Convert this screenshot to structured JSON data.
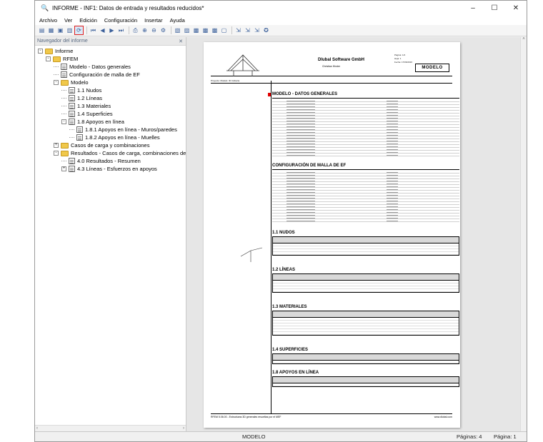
{
  "window": {
    "title": "INFORME - INF1: Datos de entrada y resultados reducidos*",
    "controls": [
      "–",
      "☐",
      "✕"
    ]
  },
  "menu": [
    "Archivo",
    "Ver",
    "Edición",
    "Configuración",
    "Insertar",
    "Ayuda"
  ],
  "navigator": {
    "header": "Navegador del informe",
    "items": [
      {
        "label": "Informe",
        "level": 0,
        "type": "folder",
        "exp": "-"
      },
      {
        "label": "RFEM",
        "level": 1,
        "type": "folder",
        "exp": "-"
      },
      {
        "label": "Modelo - Datos generales",
        "level": 2,
        "type": "page",
        "exp": ""
      },
      {
        "label": "Configuración de malla de EF",
        "level": 2,
        "type": "page",
        "exp": ""
      },
      {
        "label": "Modelo",
        "level": 2,
        "type": "folder",
        "exp": "-"
      },
      {
        "label": "1.1 Nudos",
        "level": 3,
        "type": "page",
        "exp": ""
      },
      {
        "label": "1.2 Líneas",
        "level": 3,
        "type": "page",
        "exp": ""
      },
      {
        "label": "1.3 Materiales",
        "level": 3,
        "type": "page",
        "exp": ""
      },
      {
        "label": "1.4 Superficies",
        "level": 3,
        "type": "page",
        "exp": ""
      },
      {
        "label": "1.8 Apoyos en línea",
        "level": 3,
        "type": "page",
        "exp": "-"
      },
      {
        "label": "1.8.1 Apoyos en línea - Muros/paredes",
        "level": 4,
        "type": "page",
        "exp": ""
      },
      {
        "label": "1.8.2 Apoyos en línea - Muelles",
        "level": 4,
        "type": "page",
        "exp": ""
      },
      {
        "label": "Casos de carga y combinaciones",
        "level": 2,
        "type": "folder",
        "exp": "+"
      },
      {
        "label": "Resultados - Casos de carga, combinaciones de c",
        "level": 2,
        "type": "folder",
        "exp": "-"
      },
      {
        "label": "4.0 Resultados - Resumen",
        "level": 3,
        "type": "page",
        "exp": ""
      },
      {
        "label": "4.3 Líneas - Esfuerzos en apoyos",
        "level": 3,
        "type": "page",
        "exp": "+"
      }
    ]
  },
  "document": {
    "company": "Dlubal Software GmbH",
    "company_sub": "Christian Hinder",
    "model_box": "MODELO",
    "meta": [
      "Página: 1/4",
      "Hoja: 1",
      "Fecha: 17/06/2016"
    ],
    "project_row": "Proyecto:          Modelo:   ID Cubierta",
    "sections": [
      {
        "title": "MODELO - DATOS GENERALES",
        "red": true
      },
      {
        "title": "CONFIGURACIÓN DE MALLA DE EF",
        "red": false
      },
      {
        "title": "1.1 NUDOS",
        "red": false
      },
      {
        "title": "1.2 LÍNEAS",
        "red": false
      },
      {
        "title": "1.3 MATERIALES",
        "red": false
      },
      {
        "title": "1.4 SUPERFICIES",
        "red": false
      },
      {
        "title": "1.8 APOYOS EN LÍNEA",
        "red": false
      }
    ],
    "footer_left": "RFEM 5.06.00 - Estructuras 3D generales resueltas por el MEF",
    "footer_right": "www.dlubal.com"
  },
  "status": {
    "model": "MODELO",
    "pages": "Páginas: 4",
    "page": "Página: 1"
  }
}
